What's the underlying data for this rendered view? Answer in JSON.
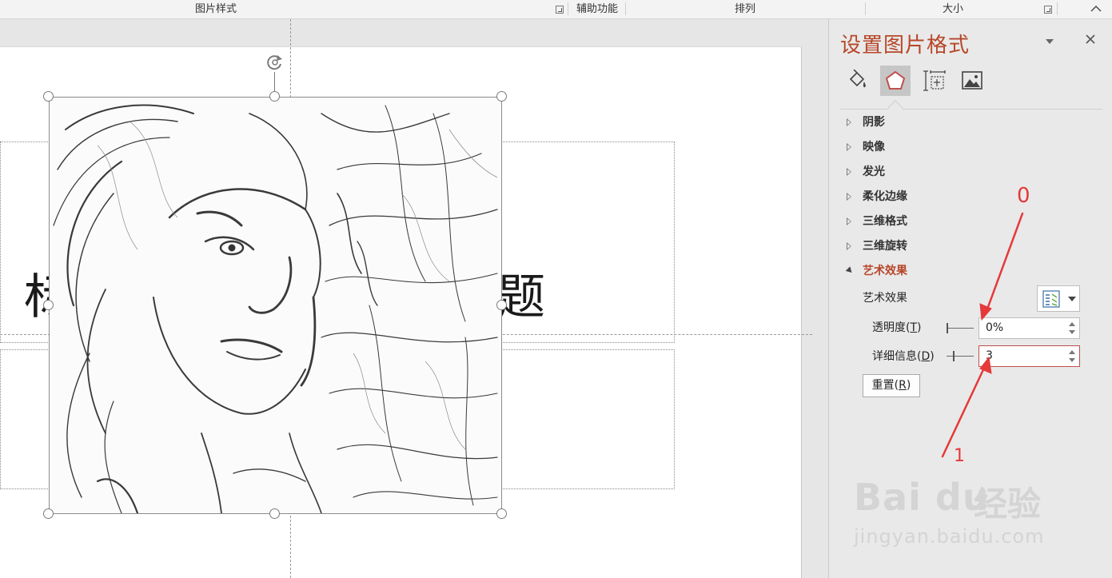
{
  "ribbon": {
    "groups": [
      {
        "label": "图片样式"
      },
      {
        "label": "辅助功能"
      },
      {
        "label": "排列"
      },
      {
        "label": "大小"
      }
    ]
  },
  "slide": {
    "title_char_left": "标",
    "title_char_right": "题"
  },
  "pane": {
    "title": "设置图片格式",
    "tabs": [
      {
        "name": "fill-line",
        "icon": "paint-bucket-icon"
      },
      {
        "name": "effects",
        "icon": "pentagon-effects-icon"
      },
      {
        "name": "size-properties",
        "icon": "size-position-icon"
      },
      {
        "name": "picture",
        "icon": "picture-icon"
      }
    ],
    "sections": [
      {
        "label": "阴影"
      },
      {
        "label": "映像"
      },
      {
        "label": "发光"
      },
      {
        "label": "柔化边缘"
      },
      {
        "label": "三维格式"
      },
      {
        "label": "三维旋转"
      },
      {
        "label": "艺术效果"
      }
    ],
    "art_effect_label": "艺术效果",
    "transparency": {
      "label": "透明度",
      "key": "T",
      "value": "0%",
      "level": 0
    },
    "detail": {
      "label": "详细信息",
      "key": "D",
      "value": "3",
      "level": 3
    },
    "reset": {
      "label": "重置",
      "key": "R"
    }
  },
  "annotations": {
    "label_top": "0",
    "label_bottom": "1",
    "color": "#e5393a"
  },
  "watermark": {
    "logo": "Bai du",
    "cn": "经验",
    "url": "jingyan.baidu.com"
  }
}
